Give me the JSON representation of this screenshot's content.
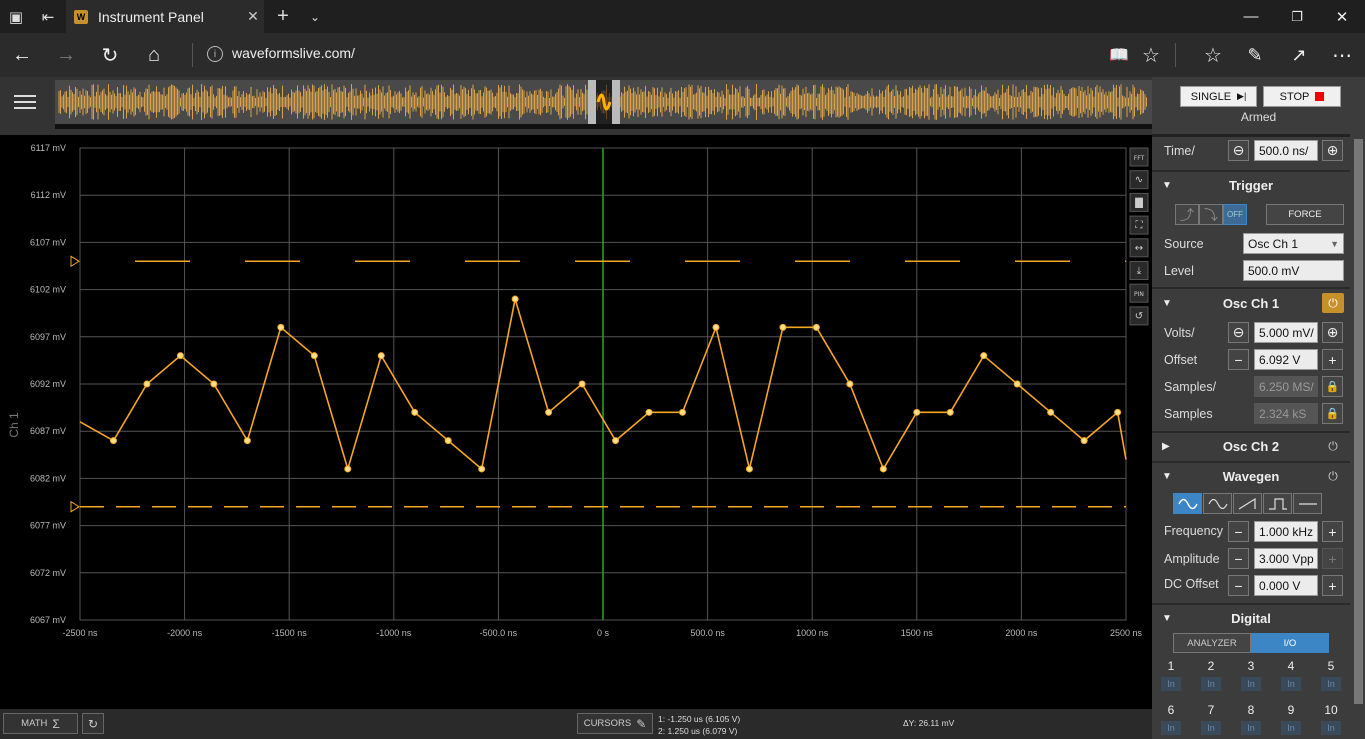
{
  "browser": {
    "tab_title": "Instrument Panel",
    "url": "waveformslive.com/"
  },
  "colors": {
    "trace": "#f5a623",
    "grid": "#555555",
    "trigger_line": "#2aa52a",
    "accent": "#3d86c6"
  },
  "plot": {
    "channel_label": "Ch 1",
    "y_ticks": [
      "6117 mV",
      "6112 mV",
      "6107 mV",
      "6102 mV",
      "6097 mV",
      "6092 mV",
      "6087 mV",
      "6082 mV",
      "6077 mV",
      "6072 mV",
      "6067 mV"
    ],
    "x_ticks": [
      "-2500 ns",
      "-2000 ns",
      "-1500 ns",
      "-1000 ns",
      "-500.0 ns",
      "0 s",
      "500.0 ns",
      "1000 ns",
      "1500 ns",
      "2000 ns",
      "2500 ns"
    ],
    "side_tools": [
      "FFT",
      "~",
      "hist",
      "fit",
      "cursor",
      "download",
      "PIN",
      "reset"
    ]
  },
  "chart_data": {
    "type": "line",
    "xlabel": "",
    "ylabel": "Ch 1",
    "xlim": [
      -2500,
      2500
    ],
    "ylim": [
      6067,
      6117
    ],
    "x_unit": "ns",
    "y_unit": "mV",
    "trigger_x": 0,
    "cursor1_mv": 6105,
    "cursor2_mv": 6079,
    "series": [
      {
        "x": [
          -2500,
          -2340,
          -2180,
          -2020,
          -1860,
          -1700,
          -1540,
          -1380,
          -1220,
          -1060,
          -900,
          -740,
          -580,
          -420,
          -260,
          -100,
          60,
          220,
          380,
          540,
          700,
          860,
          1020,
          1180,
          1340,
          1500,
          1660,
          1820,
          1980,
          2140,
          2300,
          2460,
          2500
        ],
        "values": [
          6088,
          6086,
          6092,
          6095,
          6092,
          6086,
          6098,
          6095,
          6083,
          6095,
          6089,
          6086,
          6083,
          6101,
          6089,
          6092,
          6086,
          6089,
          6089,
          6098,
          6083,
          6098,
          6098,
          6092,
          6083,
          6089,
          6089,
          6095,
          6092,
          6089,
          6086,
          6089,
          6084
        ]
      }
    ]
  },
  "bottom": {
    "math_label": "MATH",
    "cursors_label": "CURSORS",
    "cursor1": "1: -1.250 us (6.105 V)",
    "cursor2": "2: 1.250 us (6.079 V)",
    "delta_y": "ΔY: 26.11 mV"
  },
  "panel": {
    "single_label": "SINGLE",
    "stop_label": "STOP",
    "status": "Armed",
    "time_label": "Time/",
    "time_value": "500.0 ns/",
    "trigger": {
      "title": "Trigger",
      "off_label": "OFF",
      "force_label": "FORCE",
      "source_label": "Source",
      "source_value": "Osc Ch 1",
      "level_label": "Level",
      "level_value": "500.0 mV"
    },
    "osc1": {
      "title": "Osc Ch 1",
      "volts_label": "Volts/",
      "volts_value": "5.000 mV/",
      "offset_label": "Offset",
      "offset_value": "6.092 V",
      "samples_rate_label": "Samples/",
      "samples_rate_value": "6.250 MS/",
      "samples_label": "Samples",
      "samples_value": "2.324 kS"
    },
    "osc2": {
      "title": "Osc Ch 2"
    },
    "wavegen": {
      "title": "Wavegen",
      "freq_label": "Frequency",
      "freq_value": "1.000 kHz",
      "amp_label": "Amplitude",
      "amp_value": "3.000 Vpp",
      "dc_label": "DC Offset",
      "dc_value": "0.000 V"
    },
    "digital": {
      "title": "Digital",
      "tab_analyzer": "ANALYZER",
      "tab_io": "I/O",
      "pins_row1": [
        "1",
        "2",
        "3",
        "4",
        "5"
      ],
      "pins_row2": [
        "6",
        "7",
        "8",
        "9",
        "10"
      ],
      "in_label": "In"
    }
  }
}
